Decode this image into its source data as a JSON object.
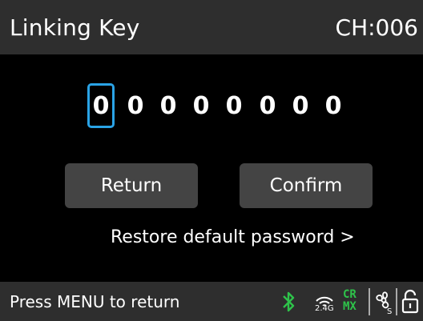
{
  "header": {
    "title": "Linking Key",
    "channel": "CH:006"
  },
  "key": {
    "digits": [
      "0",
      "0",
      "0",
      "0",
      "0",
      "0",
      "0",
      "0"
    ],
    "active_index": 0,
    "active_color": "#2aa3e6"
  },
  "buttons": {
    "return_label": "Return",
    "confirm_label": "Confirm"
  },
  "restore_link": "Restore default password >",
  "status": {
    "hint": "Press MENU to return",
    "band_label": "2.4G",
    "crmx_top": "CR",
    "crmx_bottom": "MX",
    "icons": [
      "bluetooth-icon",
      "wireless-2-4g-icon",
      "crmx-icon",
      "fan-icon",
      "unlock-icon"
    ],
    "accent_green": "#2ec34a"
  }
}
